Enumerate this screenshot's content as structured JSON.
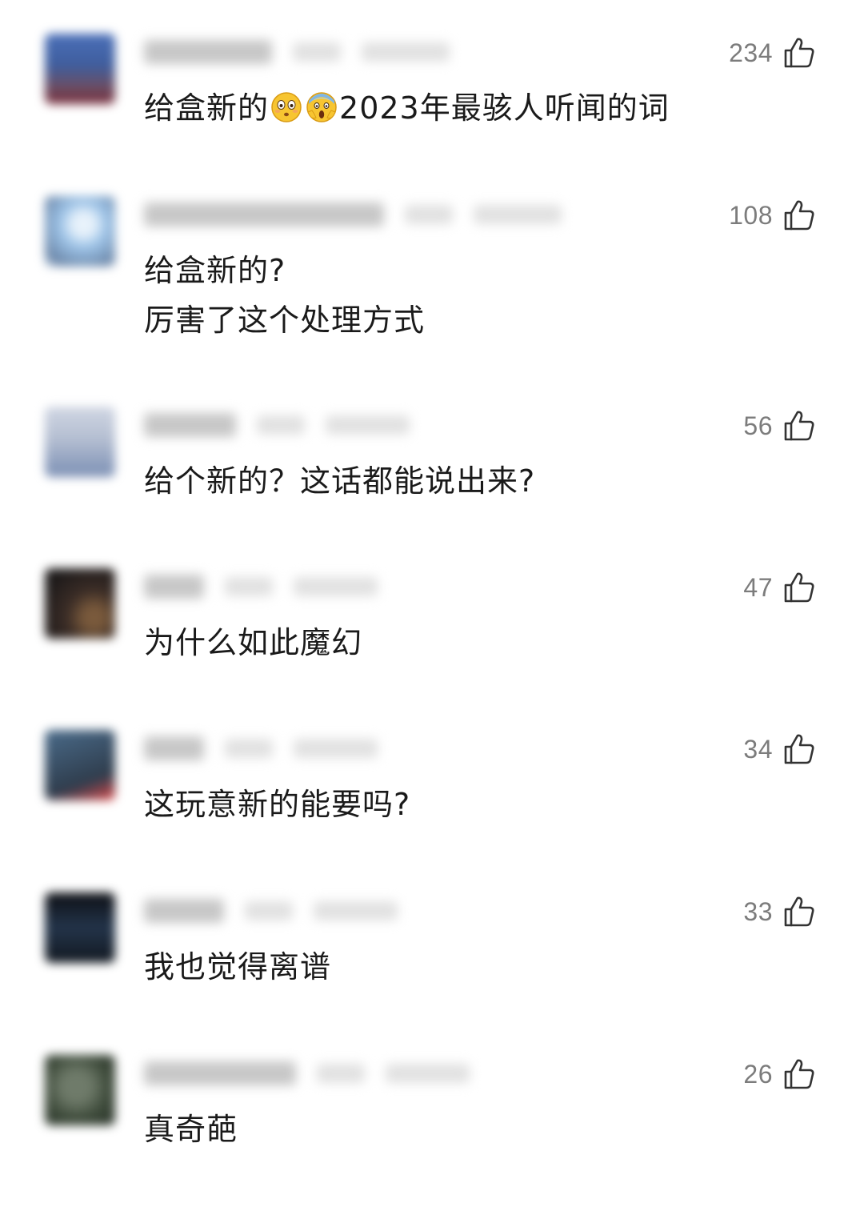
{
  "comments": [
    {
      "text": "给盒新的",
      "text_after_emoji": "2023年最骇人听闻的词",
      "emojis": [
        "flushed-face-emoji",
        "screaming-face-emoji"
      ],
      "likes": "234",
      "avatar_colors": [
        "#3f5e9e",
        "#4b5c7e",
        "#7a2d3a"
      ]
    },
    {
      "text": "给盒新的?\n厉害了这个处理方式",
      "likes": "108",
      "avatar_colors": [
        "#9ec4e8",
        "#6b86a8",
        "#c8d8e8"
      ]
    },
    {
      "text": "给个新的？这话都能说出来?",
      "likes": "56",
      "avatar_colors": [
        "#b5bfd2",
        "#7b8fb4",
        "#d0d6e3"
      ]
    },
    {
      "text": "为什么如此魔幻",
      "likes": "47",
      "avatar_colors": [
        "#1d1a1a",
        "#3a2c26",
        "#7a5a3c"
      ]
    },
    {
      "text": "这玩意新的能要吗?",
      "likes": "34",
      "avatar_colors": [
        "#4a6b8a",
        "#2f3d4d",
        "#e34b4b"
      ]
    },
    {
      "text": "我也觉得离谱",
      "likes": "33",
      "avatar_colors": [
        "#121820",
        "#23344a",
        "#0d0f14"
      ]
    },
    {
      "text": "真奇葩",
      "likes": "26",
      "avatar_colors": [
        "#3d4a3a",
        "#6f7b6a",
        "#2a332a"
      ]
    }
  ],
  "icons": {
    "like": "thumbs-up-outline-icon"
  },
  "colors": {
    "text": "#1a1a1a",
    "like_count": "#7c7c7c",
    "icon": "#333333"
  }
}
